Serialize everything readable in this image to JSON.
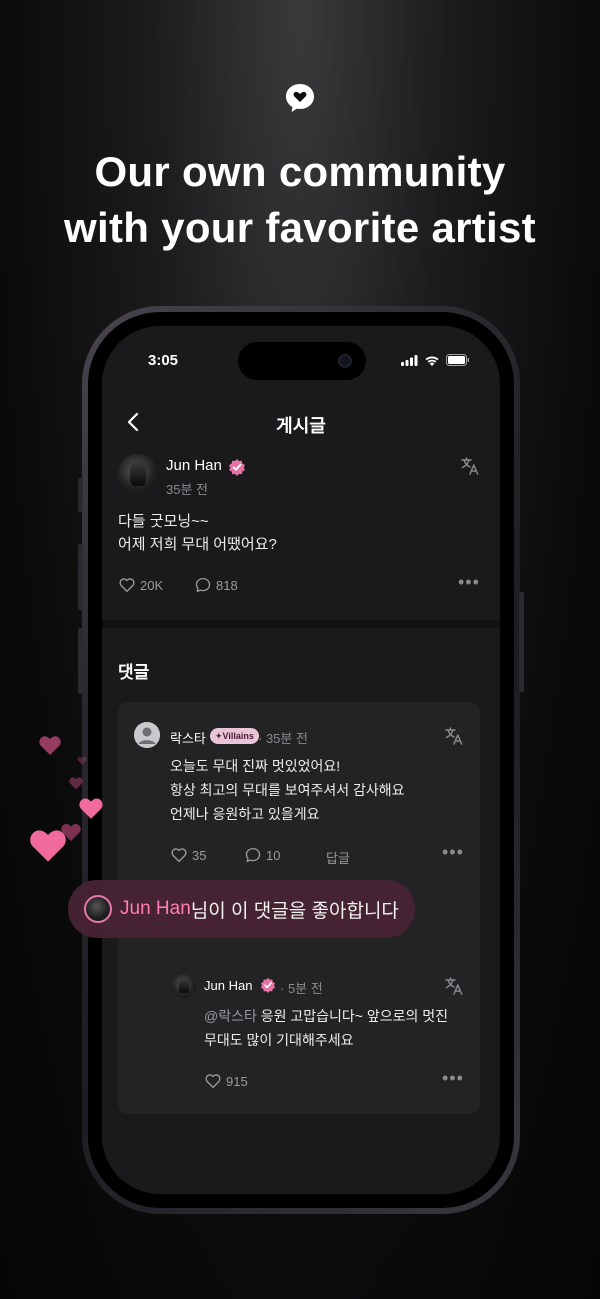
{
  "promo": {
    "headline_line1": "Our own community",
    "headline_line2": "with your favorite artist"
  },
  "status_bar": {
    "time": "3:05"
  },
  "nav": {
    "title": "게시글"
  },
  "post": {
    "author": "Jun Han",
    "time": "35분 전",
    "body_line1": "다들 굿모닝~~",
    "body_line2": "어제 저희 무대 어땠어요?",
    "likes": "20K",
    "comments": "818"
  },
  "comments_section": {
    "title": "댓글"
  },
  "comment": {
    "author": "락스타",
    "badge": "✦Villains",
    "time": "· 35분 전",
    "body_line1": "오늘도 무대 진짜 멋있었어요!",
    "body_line2": "항상 최고의 무대를 보여주셔서 감사해요",
    "body_line3": "언제나 응원하고 있을게요",
    "likes": "35",
    "replies": "10",
    "reply_label": "답글"
  },
  "reply": {
    "author": "Jun Han",
    "time": "· 5분 전",
    "mention": "@락스타",
    "body_line1_rest": " 응원 고맙습니다~ 앞으로의 멋진",
    "body_line2": "무대도 많이 기대해주세요",
    "likes": "915"
  },
  "toast": {
    "name": "Jun Han",
    "message": "님이 이 댓글을 좋아합니다"
  },
  "colors": {
    "accent_pink": "#ff7cb4",
    "verified": "#e573a6",
    "heart": "#f06a9e"
  }
}
